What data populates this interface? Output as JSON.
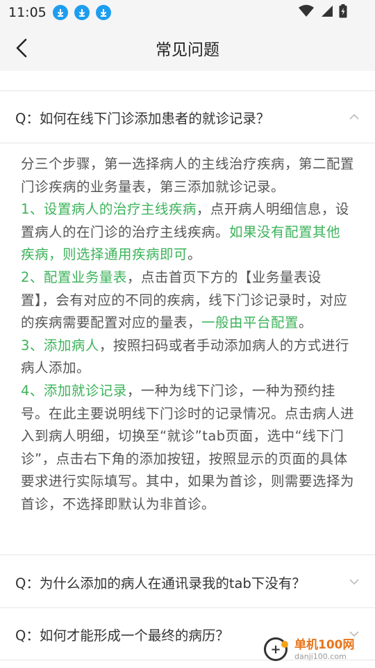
{
  "status": {
    "time": "11:05"
  },
  "nav": {
    "title": "常见问题"
  },
  "faq": {
    "q1": "Q：如何在线下门诊添加患者的就诊记录？",
    "a1": {
      "intro": "分三个步骤，第一选择病人的主线治疗疾病，第二配置门诊疾病的业务量表，第三添加就诊记录。",
      "s1_head": "1、设置病人的治疗主线疾病",
      "s1_body": "，点开病人明细信息，设置病人的在门诊的治疗主线疾病。",
      "s1_tip": "如果没有配置其他疾病，则选择通用疾病即可",
      "s1_end": "。",
      "s2_head": "2、配置业务量表",
      "s2_body": "，点击首页下方的【业务量表设置】，会有对应的不同的疾病，线下门诊记录时，对应的疾病需要配置对应的量表，",
      "s2_tip": "一般由平台配置",
      "s2_end": "。",
      "s3_head": "3、添加病人",
      "s3_body": "，按照扫码或者手动添加病人的方式进行病人添加。",
      "s4_head": "4、添加就诊记录",
      "s4_body": "，一种为线下门诊，一种为预约挂号。在此主要说明线下门诊时的记录情况。点击病人进入到病人明细，切换至“就诊”tab页面，选中“线下门诊”，点击右下角的添加按钮，按照显示的页面的具体要求进行实际填写。其中，如果为首诊，则需要选择为首诊，不选择即默认为非首诊。"
    },
    "q2": "Q：为什么添加的病人在通讯录我的tab下没有？",
    "q3": "Q：如何才能形成一个最终的病历？"
  },
  "watermark": {
    "main": "单机100网",
    "sub": "danji100.com"
  },
  "colors": {
    "accent_green": "#3cb35a",
    "download_blue": "#1e9df0"
  }
}
